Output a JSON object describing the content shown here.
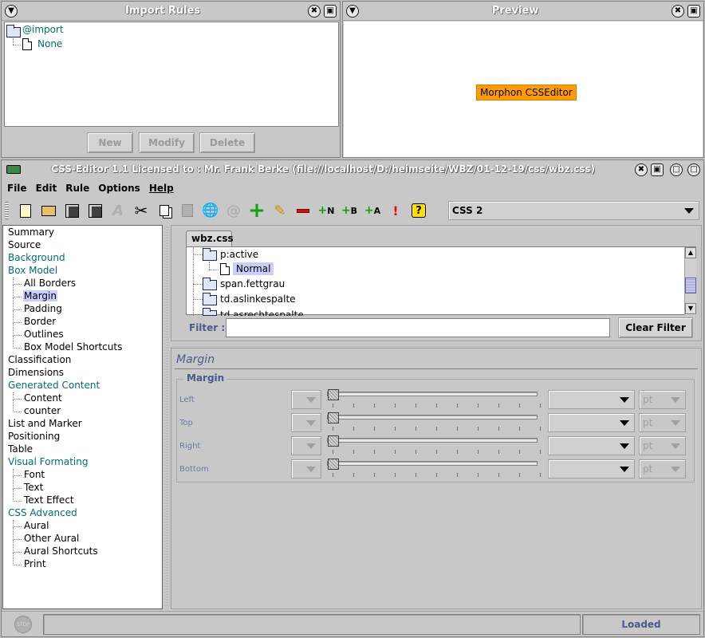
{
  "import_panel": {
    "title": "Import Rules",
    "root_label": "@import",
    "child_label": "None",
    "buttons": {
      "new": "New",
      "modify": "Modify",
      "delete": "Delete"
    }
  },
  "preview_panel": {
    "title": "Preview",
    "sample_text": "Morphon CSSEditor"
  },
  "main_window": {
    "title": "CSS-Editor 1.1  Licensed to : Mr. Frank Berke  (file://localhost/D:/heimseite/WBZ/01-12-19/css/wbz.css)"
  },
  "menu": [
    "File",
    "Edit",
    "Rule",
    "Options",
    "Help"
  ],
  "toolbar": {
    "css_version": "CSS 2",
    "icons": [
      "new-file-icon",
      "open-folder-icon",
      "save-icon",
      "save-as-icon",
      "font-icon",
      "cut-icon",
      "copy-icon",
      "paste-icon",
      "validate-globe-icon",
      "link-icon",
      "add-rule-icon",
      "edit-rule-icon",
      "remove-rule-icon",
      "add-n-icon",
      "add-b-icon",
      "add-a-icon",
      "important-icon",
      "help-icon"
    ],
    "labels": {
      "n": "N",
      "b": "B",
      "a": "A",
      "important": "!",
      "help": "?"
    }
  },
  "nav": [
    {
      "label": "Summary",
      "indent": false,
      "group": false
    },
    {
      "label": "Source",
      "indent": false,
      "group": false
    },
    {
      "label": "Background",
      "indent": false,
      "group": true
    },
    {
      "label": "Box Model",
      "indent": false,
      "group": true
    },
    {
      "label": "All Borders",
      "indent": true,
      "group": false
    },
    {
      "label": "Margin",
      "indent": true,
      "group": false,
      "selected": true
    },
    {
      "label": "Padding",
      "indent": true,
      "group": false
    },
    {
      "label": "Border",
      "indent": true,
      "group": false
    },
    {
      "label": "Outlines",
      "indent": true,
      "group": false
    },
    {
      "label": "Box Model Shortcuts",
      "indent": true,
      "group": false
    },
    {
      "label": "Classification",
      "indent": false,
      "group": false
    },
    {
      "label": "Dimensions",
      "indent": false,
      "group": false
    },
    {
      "label": "Generated Content",
      "indent": false,
      "group": true
    },
    {
      "label": "Content",
      "indent": true,
      "group": false
    },
    {
      "label": "counter",
      "indent": true,
      "group": false
    },
    {
      "label": "List and Marker",
      "indent": false,
      "group": false
    },
    {
      "label": "Positioning",
      "indent": false,
      "group": false
    },
    {
      "label": "Table",
      "indent": false,
      "group": false
    },
    {
      "label": "Visual Formating",
      "indent": false,
      "group": true
    },
    {
      "label": "Font",
      "indent": true,
      "group": false
    },
    {
      "label": "Text",
      "indent": true,
      "group": false
    },
    {
      "label": "Text Effect",
      "indent": true,
      "group": false
    },
    {
      "label": "CSS Advanced",
      "indent": false,
      "group": true
    },
    {
      "label": "Aural",
      "indent": true,
      "group": false
    },
    {
      "label": "Other Aural",
      "indent": true,
      "group": false
    },
    {
      "label": "Aural Shortcuts",
      "indent": true,
      "group": false
    },
    {
      "label": "Print",
      "indent": true,
      "group": false
    }
  ],
  "stylesheet": {
    "tab": "wbz.css",
    "rules": [
      "p:active",
      "Normal",
      "span.fettgrau",
      "td.aslinkespalte",
      "td.asrechtespalte"
    ],
    "filter_label": "Filter :",
    "filter_value": "",
    "clear_filter": "Clear Filter"
  },
  "editor": {
    "panel_title": "Margin",
    "group_title": "Margin",
    "rows": [
      {
        "label": "Left",
        "unit": "pt"
      },
      {
        "label": "Top",
        "unit": "pt"
      },
      {
        "label": "Right",
        "unit": "pt"
      },
      {
        "label": "Bottom",
        "unit": "pt"
      }
    ]
  },
  "status": {
    "stop_label": "STOP",
    "message": "",
    "state": "Loaded"
  },
  "colors": {
    "teal": "#00706e",
    "selection": "#ccccff",
    "preview_bg": "#ff9c00",
    "status_text": "#4a5a8a"
  }
}
